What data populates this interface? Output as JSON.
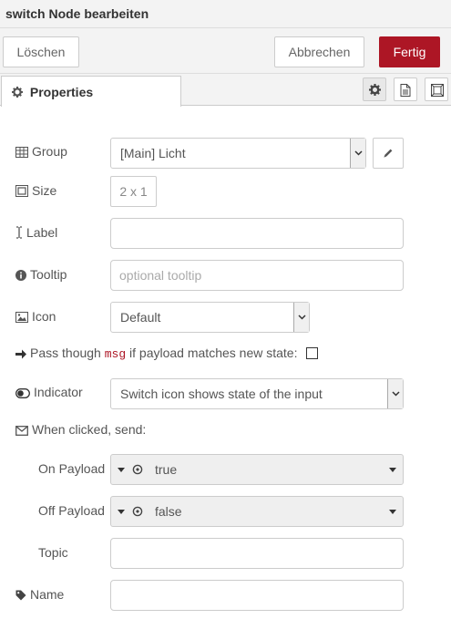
{
  "header": {
    "title": "switch Node bearbeiten"
  },
  "toolbar": {
    "delete_label": "Löschen",
    "cancel_label": "Abbrechen",
    "done_label": "Fertig"
  },
  "tabs": {
    "properties_label": "Properties"
  },
  "form": {
    "group": {
      "label": "Group",
      "value": "[Main] Licht"
    },
    "size": {
      "label": "Size",
      "value": "2 x 1"
    },
    "label_field": {
      "label": "Label",
      "value": ""
    },
    "tooltip": {
      "label": "Tooltip",
      "placeholder": "optional tooltip"
    },
    "icon": {
      "label": "Icon",
      "value": "Default"
    },
    "passthrough": {
      "prefix": "Pass though",
      "code": "msg",
      "suffix": "if payload matches new state:",
      "checked": false
    },
    "indicator": {
      "label": "Indicator",
      "value": "Switch icon shows state of the input"
    },
    "when_clicked": {
      "label": "When clicked, send:"
    },
    "on_payload": {
      "label": "On Payload",
      "value": "true"
    },
    "off_payload": {
      "label": "Off Payload",
      "value": "false"
    },
    "topic": {
      "label": "Topic",
      "value": ""
    },
    "name": {
      "label": "Name",
      "value": ""
    }
  },
  "colors": {
    "primary": "#ad1625",
    "header_bg": "#f3f3f3"
  }
}
